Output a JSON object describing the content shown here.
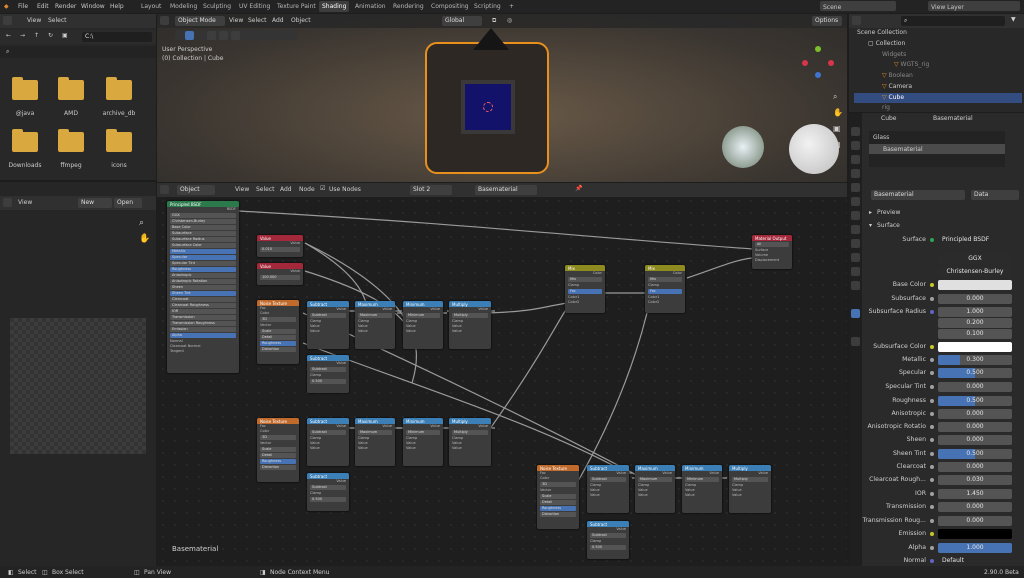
{
  "topbar": {
    "menus": [
      "File",
      "Edit",
      "Render",
      "Window",
      "Help"
    ],
    "workspaces": [
      "Layout",
      "Modeling",
      "Sculpting",
      "UV Editing",
      "Texture Paint",
      "Shading",
      "Animation",
      "Rendering",
      "Compositing",
      "Scripting"
    ],
    "active": "Shading",
    "scene": "Scene",
    "view_layer": "View Layer"
  },
  "file_browser": {
    "menu": [
      "View",
      "Select"
    ],
    "path": "C:\\",
    "folders": [
      "@java",
      "AMD",
      "archive_db",
      "Downloads",
      "ffmpeg",
      "icons"
    ]
  },
  "image_editor": {
    "menu": "View",
    "new": "New",
    "open": "Open"
  },
  "viewport": {
    "mode": "Object Mode",
    "menus": [
      "View",
      "Select",
      "Add",
      "Object"
    ],
    "perspective": "User Perspective",
    "collection": "(0) Collection | Cube",
    "transform": "Global",
    "options": "Options"
  },
  "node_editor": {
    "type": "Object",
    "menus": [
      "View",
      "Select",
      "Add",
      "Node"
    ],
    "use_nodes": "Use Nodes",
    "slot": "Slot 2",
    "material": "Basematerial",
    "label": "Basematerial"
  },
  "outliner": {
    "root": "Scene Collection",
    "items": [
      "Collection",
      "Widgets",
      "WGTS_rig",
      "Boolean",
      "Camera",
      "Cube",
      "rig"
    ]
  },
  "properties": {
    "object": "Cube",
    "material": "Basematerial",
    "slots": [
      "Glass",
      "Basematerial"
    ],
    "mat_name": "Basematerial",
    "data": "Data",
    "preview": "Preview",
    "surface_section": "Surface",
    "surface_label": "Surface",
    "surface_value": "Principled BSDF",
    "distribution": "GGX",
    "subsurface_method": "Christensen-Burley",
    "rows": [
      {
        "label": "Base Color",
        "type": "color",
        "color": "#e0e0e0",
        "dot": "#c7c729"
      },
      {
        "label": "Subsurface",
        "value": "0.000",
        "fill": 0,
        "dot": "#a1a1a1"
      },
      {
        "label": "Subsurface Radius",
        "value": "1.000",
        "fill": 0,
        "dot": "#6363c7"
      },
      {
        "label": "",
        "value": "0.200",
        "fill": 0
      },
      {
        "label": "",
        "value": "0.100",
        "fill": 0
      },
      {
        "label": "Subsurface Color",
        "type": "color",
        "color": "#ffffff",
        "dot": "#c7c729"
      },
      {
        "label": "Metallic",
        "value": "0.300",
        "fill": 0.3,
        "dot": "#a1a1a1"
      },
      {
        "label": "Specular",
        "value": "0.500",
        "fill": 0.5,
        "dot": "#a1a1a1"
      },
      {
        "label": "Specular Tint",
        "value": "0.000",
        "fill": 0,
        "dot": "#a1a1a1"
      },
      {
        "label": "Roughness",
        "value": "0.500",
        "fill": 0.5,
        "dot": "#a1a1a1"
      },
      {
        "label": "Anisotropic",
        "value": "0.000",
        "fill": 0,
        "dot": "#a1a1a1"
      },
      {
        "label": "Anisotropic Rotatio",
        "value": "0.000",
        "fill": 0,
        "dot": "#a1a1a1"
      },
      {
        "label": "Sheen",
        "value": "0.000",
        "fill": 0,
        "dot": "#a1a1a1"
      },
      {
        "label": "Sheen Tint",
        "value": "0.500",
        "fill": 0.5,
        "dot": "#a1a1a1"
      },
      {
        "label": "Clearcoat",
        "value": "0.000",
        "fill": 0,
        "dot": "#a1a1a1"
      },
      {
        "label": "Clearcoat Rough...",
        "value": "0.030",
        "fill": 0,
        "dot": "#a1a1a1"
      },
      {
        "label": "IOR",
        "value": "1.450",
        "fill": 0,
        "dot": "#a1a1a1"
      },
      {
        "label": "Transmission",
        "value": "0.000",
        "fill": 0,
        "dot": "#a1a1a1"
      },
      {
        "label": "Transmission Roug...",
        "value": "0.000",
        "fill": 0,
        "dot": "#a1a1a1"
      },
      {
        "label": "Emission",
        "type": "color",
        "color": "#000000",
        "dot": "#c7c729"
      },
      {
        "label": "Alpha",
        "value": "1.000",
        "fill": 1,
        "dot": "#a1a1a1"
      },
      {
        "label": "Normal",
        "value": "Default",
        "type": "text",
        "dot": "#6363c7"
      }
    ]
  },
  "statusbar": {
    "items": [
      "Select",
      "Box Select",
      "Pan View",
      "Node Context Menu"
    ],
    "version": "2.90.0 Beta"
  }
}
